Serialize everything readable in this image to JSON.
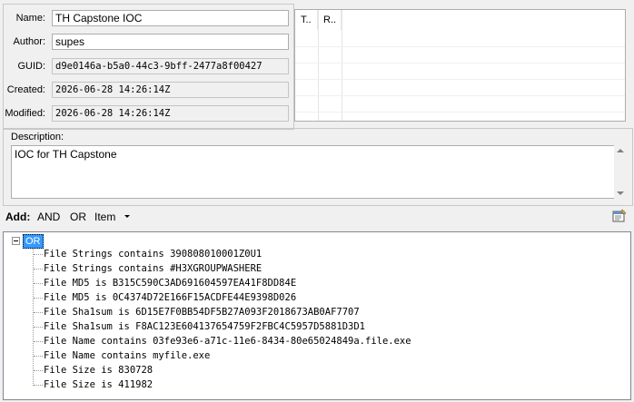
{
  "form": {
    "name_label": "Name:",
    "name_value": "TH Capstone IOC",
    "author_label": "Author:",
    "author_value": "supes",
    "guid_label": "GUID:",
    "guid_value": "d9e0146a-b5a0-44c3-9bff-2477a8f00427",
    "created_label": "Created:",
    "created_value": "2026-06-28 14:26:14Z",
    "modified_label": "Modified:",
    "modified_value": "2026-06-28 14:26:14Z"
  },
  "list": {
    "col1": "T..",
    "col2": "R.."
  },
  "description": {
    "label": "Description:",
    "value": "IOC for TH Capstone"
  },
  "toolbar": {
    "add_label": "Add:",
    "and_label": "AND",
    "or_label": "OR",
    "item_label": "Item"
  },
  "tree": {
    "root_label": "OR",
    "items": [
      "File Strings contains 390808010001Z0U1",
      "File Strings contains #H3XGROUPWASHERE",
      "File MD5 is B315C590C3AD691604597EA41F8DD84E",
      "File MD5 is 0C4374D72E166F15ACDFE44E9398D026",
      "File Sha1sum is 6D15E7F0BB54DF5B27A093F2018673AB0AF7707",
      "File Sha1sum is F8AC123E604137654759F2FBC4C5957D5881D3D1",
      "File Name contains 03fe93e6-a71c-11e6-8434-80e65024849a.file.exe",
      "File Name contains myfile.exe",
      "File Size is 830728",
      "File Size is 411982"
    ]
  }
}
